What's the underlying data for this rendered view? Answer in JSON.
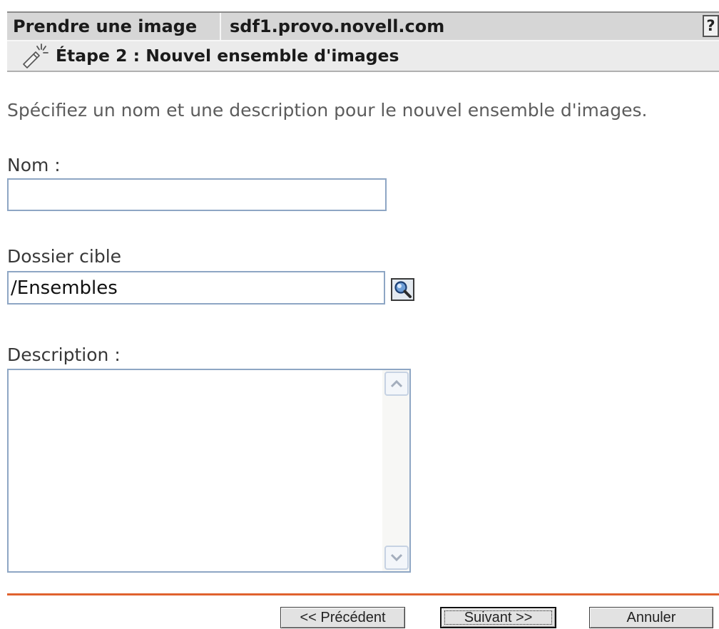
{
  "header": {
    "page_title": "Prendre une image",
    "server_name": "sdf1.provo.novell.com",
    "help_label": "?",
    "step_icon": "wizard-wand-icon",
    "step_title": "Étape 2 : Nouvel ensemble d'images"
  },
  "instructions": "Spécifiez un nom et une description pour le nouvel ensemble d'images.",
  "form": {
    "name": {
      "label": "Nom :",
      "value": ""
    },
    "target_folder": {
      "label": "Dossier cible",
      "value": "/Ensembles",
      "browse_icon": "search-icon"
    },
    "description": {
      "label": "Description :",
      "value": "",
      "scroll_up_icon": "chevron-up-icon",
      "scroll_down_icon": "chevron-down-icon"
    }
  },
  "buttons": {
    "previous": "<< Précédent",
    "next": "Suivant >>",
    "cancel": "Annuler"
  },
  "colors": {
    "header_bg": "#d6d6d6",
    "subheader_bg": "#ebebeb",
    "divider": "#e0622e",
    "input_border": "#8ea6c4"
  }
}
